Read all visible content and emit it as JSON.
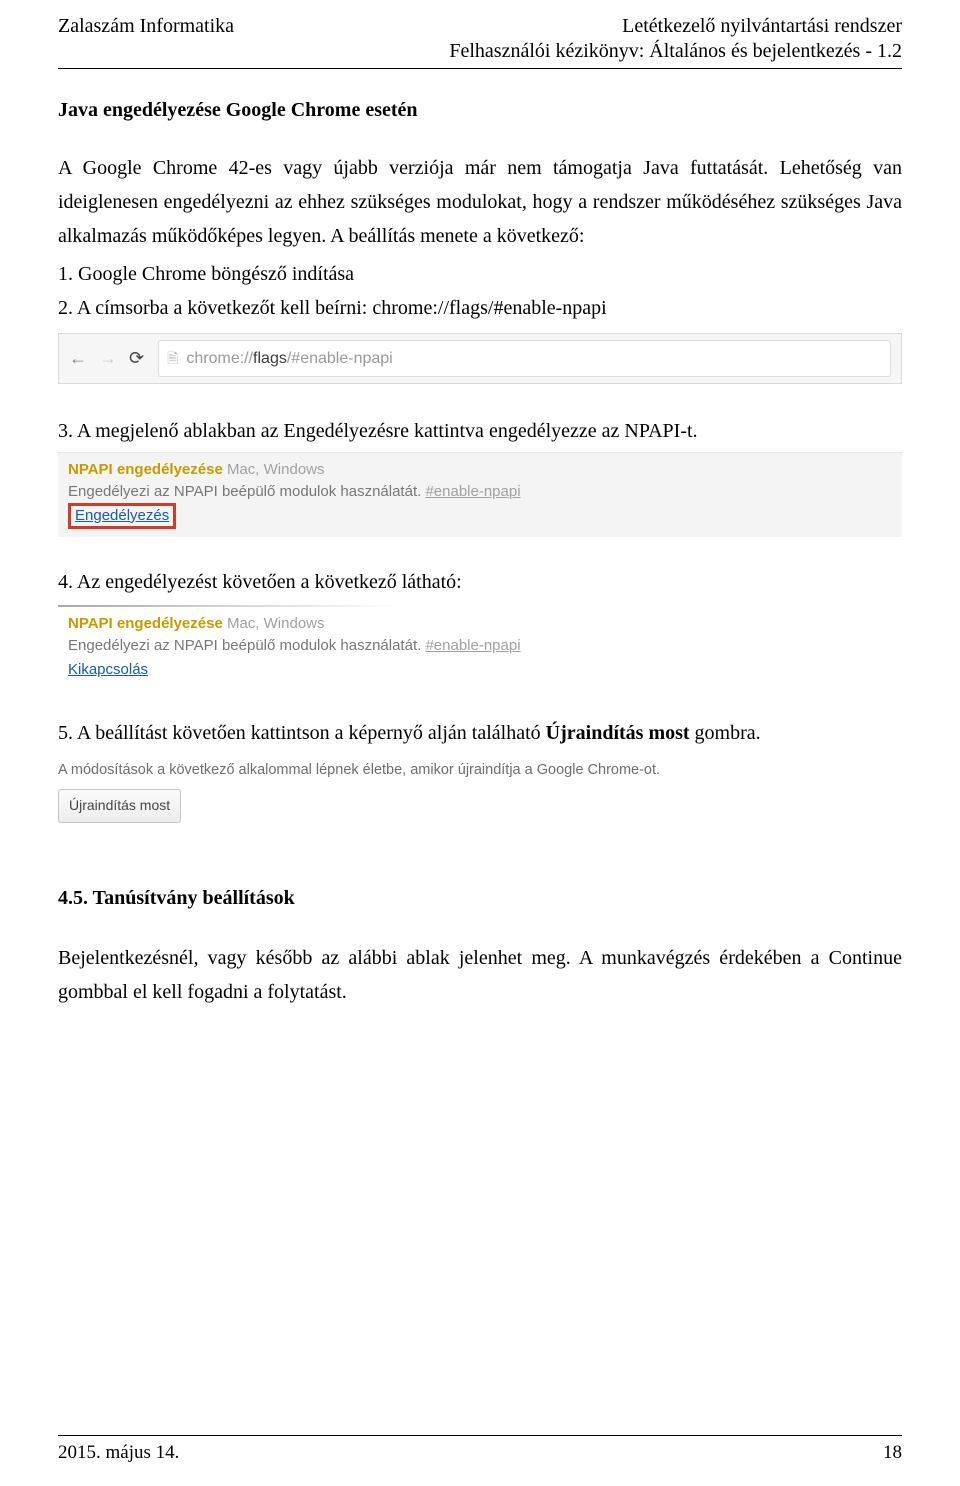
{
  "header": {
    "left": "Zalaszám Informatika",
    "right_line1": "Letétkezelő nyilvántartási rendszer",
    "right_line2": "Felhasználói kézikönyv: Általános és bejelentkezés - 1.2"
  },
  "body": {
    "section_title": "Java engedélyezése Google Chrome esetén",
    "intro_para": "A Google Chrome 42-es vagy újabb verziója már nem támogatja Java futtatását. Lehetőség van ideiglenesen engedélyezni az ehhez szükséges modulokat, hogy a rendszer működéséhez szükséges Java alkalmazás működőképes legyen. A beállítás menete a következő:",
    "step1": "1. Google Chrome böngésző indítása",
    "step2": "2. A címsorba a következőt kell beírni: chrome://flags/#enable-npapi",
    "chrome_bar": {
      "scheme": "chrome://",
      "host": "flags",
      "rest": "/#enable-npapi"
    },
    "step3": "3. A megjelenő ablakban az Engedélyezésre kattintva engedélyezze az NPAPI-t.",
    "npapi": {
      "title": "NPAPI engedélyezése",
      "platforms": "Mac, Windows",
      "desc": "Engedélyezi az NPAPI beépülő modulok használatát.",
      "hash": "#enable-npapi",
      "enable_link": "Engedélyezés",
      "disable_link": "Kikapcsolás"
    },
    "step4": "4. Az engedélyezést követően a következő látható:",
    "step5_pre": "5. A beállítást követően kattintson a képernyő alján található ",
    "step5_bold": "Újraindítás most",
    "step5_post": " gombra.",
    "restart": {
      "note": "A módosítások a következő alkalommal lépnek életbe, amikor újraindítja a Google Chrome-ot.",
      "button": "Újraindítás most"
    },
    "subheading": "4.5. Tanúsítvány beállítások",
    "closing": "Bejelentkezésnél, vagy később az alábbi ablak jelenhet meg. A munkavégzés érdekében a Continue gombbal el kell fogadni a folytatást."
  },
  "footer": {
    "date": "2015. május 14.",
    "page": "18"
  }
}
